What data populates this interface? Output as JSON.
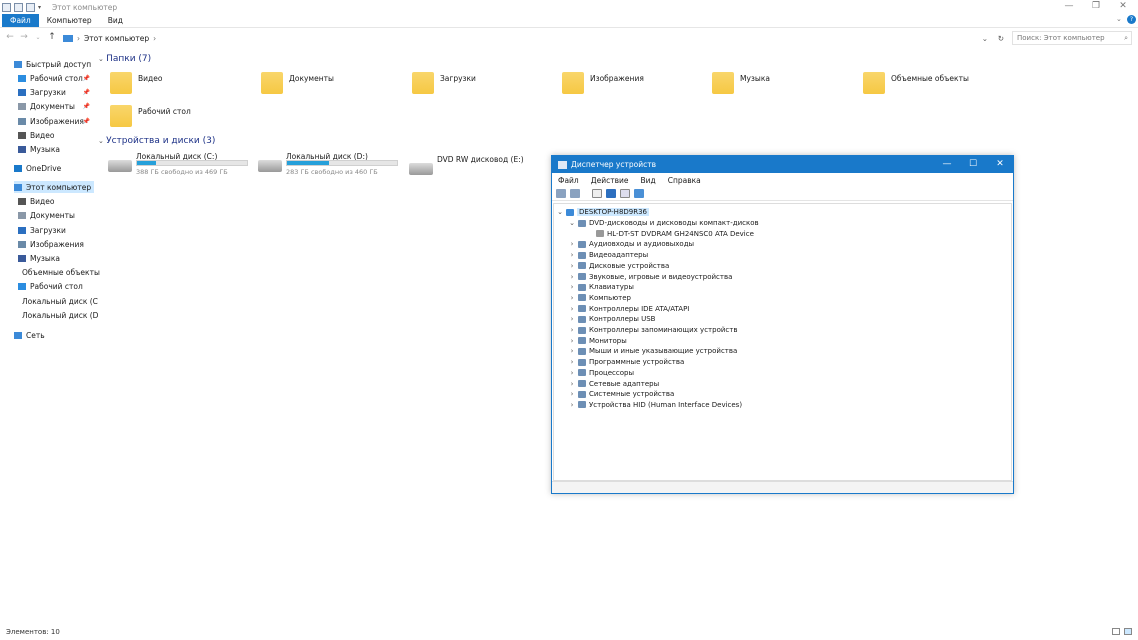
{
  "window": {
    "title": "Этот компьютер",
    "controls": {
      "minimize": "—",
      "restore": "❐",
      "close": "✕"
    }
  },
  "ribbon": {
    "tabs": [
      "Файл",
      "Компьютер",
      "Вид"
    ]
  },
  "address": {
    "path": "Этот компьютер",
    "search_placeholder": "Поиск: Этот компьютер"
  },
  "sidebar": {
    "items": [
      {
        "label": "Быстрый доступ",
        "icon": "star-icon",
        "pinned": false
      },
      {
        "label": "Рабочий стол",
        "icon": "desktop-icon",
        "pinned": true
      },
      {
        "label": "Загрузки",
        "icon": "download-icon",
        "pinned": true
      },
      {
        "label": "Документы",
        "icon": "document-icon",
        "pinned": true
      },
      {
        "label": "Изображения",
        "icon": "image-icon",
        "pinned": true
      },
      {
        "label": "Видео",
        "icon": "video-icon",
        "pinned": false
      },
      {
        "label": "Музыка",
        "icon": "music-icon",
        "pinned": false
      },
      {
        "label": "OneDrive",
        "icon": "cloud-icon",
        "pinned": false
      },
      {
        "label": "Этот компьютер",
        "icon": "computer-icon",
        "pinned": false
      },
      {
        "label": "Видео",
        "icon": "video-icon",
        "pinned": false
      },
      {
        "label": "Документы",
        "icon": "document-icon",
        "pinned": false
      },
      {
        "label": "Загрузки",
        "icon": "download-icon",
        "pinned": false
      },
      {
        "label": "Изображения",
        "icon": "image-icon",
        "pinned": false
      },
      {
        "label": "Музыка",
        "icon": "music-icon",
        "pinned": false
      },
      {
        "label": "Объемные объекты",
        "icon": "cube-icon",
        "pinned": false
      },
      {
        "label": "Рабочий стол",
        "icon": "desktop-icon",
        "pinned": false
      },
      {
        "label": "Локальный диск (C",
        "icon": "drive-icon",
        "pinned": false
      },
      {
        "label": "Локальный диск (D",
        "icon": "drive-icon",
        "pinned": false
      },
      {
        "label": "Сеть",
        "icon": "network-icon",
        "pinned": false
      }
    ]
  },
  "folders": {
    "header": "Папки (7)",
    "items": [
      "Видео",
      "Документы",
      "Загрузки",
      "Изображения",
      "Музыка",
      "Объемные объекты",
      "Рабочий стол"
    ]
  },
  "devices": {
    "header": "Устройства и диски (3)",
    "drives": [
      {
        "name": "Локальный диск (C:)",
        "free": "388 ГБ свободно из 469 ГБ",
        "used_fraction": 0.17
      },
      {
        "name": "Локальный диск (D:)",
        "free": "283 ГБ свободно из 460 ГБ",
        "used_fraction": 0.38
      },
      {
        "name": "DVD RW дисковод (E:)",
        "free": "",
        "used_fraction": null
      }
    ]
  },
  "status": {
    "items": "Элементов: 10"
  },
  "device_manager": {
    "title": "Диспетчер устройств",
    "menu": [
      "Файл",
      "Действие",
      "Вид",
      "Справка"
    ],
    "root": "DESKTOP-H8D9R36",
    "tree": [
      {
        "label": "DVD-дисководы и дисководы компакт-дисков",
        "expanded": true
      },
      {
        "label": "HL-DT-ST DVDRAM GH24NSC0 ATA Device",
        "child": true
      },
      {
        "label": "Аудиовходы и аудиовыходы"
      },
      {
        "label": "Видеоадаптеры"
      },
      {
        "label": "Дисковые устройства"
      },
      {
        "label": "Звуковые, игровые и видеоустройства"
      },
      {
        "label": "Клавиатуры"
      },
      {
        "label": "Компьютер"
      },
      {
        "label": "Контроллеры IDE ATA/ATAPI"
      },
      {
        "label": "Контроллеры USB"
      },
      {
        "label": "Контроллеры запоминающих устройств"
      },
      {
        "label": "Мониторы"
      },
      {
        "label": "Мыши и иные указывающие устройства"
      },
      {
        "label": "Программные устройства"
      },
      {
        "label": "Процессоры"
      },
      {
        "label": "Сетевые адаптеры"
      },
      {
        "label": "Системные устройства"
      },
      {
        "label": "Устройства HID (Human Interface Devices)"
      }
    ]
  },
  "colors": {
    "accent": "#1979ca",
    "drive_fill": "#26a0da",
    "folder": "#f6c843",
    "selection": "#cce8ff"
  }
}
